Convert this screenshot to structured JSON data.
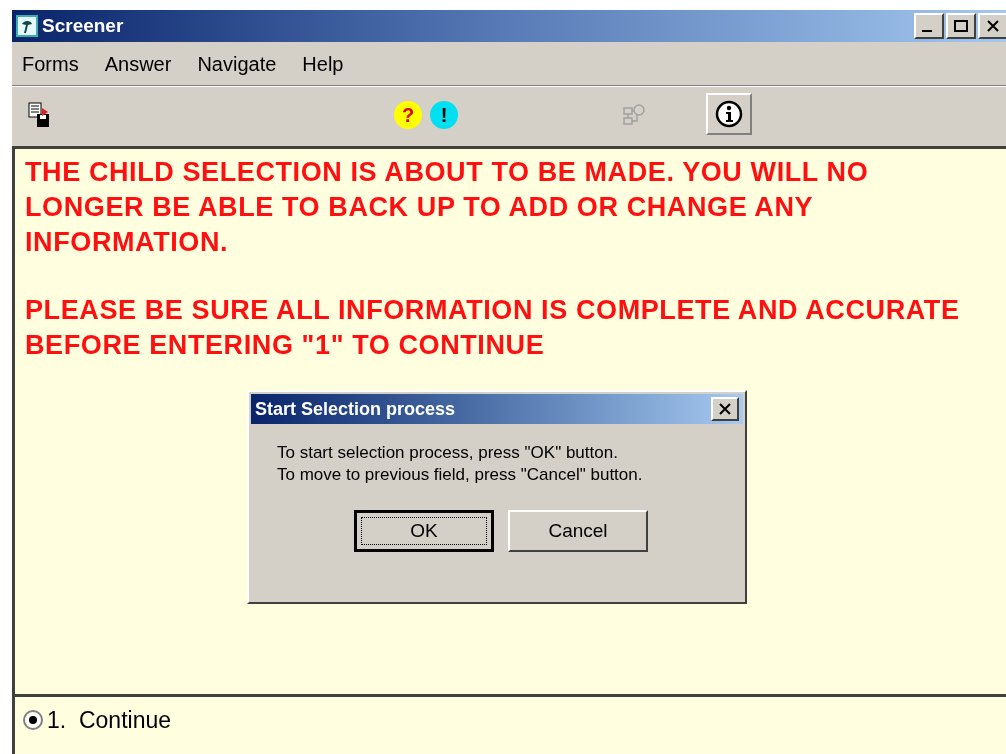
{
  "window": {
    "title": "Screener"
  },
  "menu": [
    "Forms",
    "Answer",
    "Navigate",
    "Help"
  ],
  "toolbar": [
    {
      "kind": "save"
    },
    {
      "kind": "glyph",
      "text": "?",
      "color": "#ffff00",
      "disabled": false
    },
    {
      "kind": "glyph",
      "text": "!",
      "color": "#00e0f0",
      "disabled": false
    },
    {
      "kind": "tree",
      "disabled": true
    },
    {
      "kind": "info",
      "pressed": true
    }
  ],
  "message": [
    "THE CHILD SELECTION IS ABOUT TO BE MADE. YOU WILL NO LONGER BE ABLE TO BACK UP TO ADD OR CHANGE ANY INFORMATION.",
    "PLEASE BE SURE ALL INFORMATION IS COMPLETE AND ACCURATE BEFORE ENTERING \"1\" TO CONTINUE"
  ],
  "dialog": {
    "title": "Start Selection process",
    "lines": [
      "To start selection process, press \"OK\" button.",
      "To move to previous field, press \"Cancel\" button."
    ],
    "buttons": [
      {
        "label": "OK",
        "default": true
      },
      {
        "label": "Cancel",
        "default": false
      }
    ]
  },
  "answers": [
    {
      "label": "1.  Continue",
      "selected": true
    }
  ]
}
